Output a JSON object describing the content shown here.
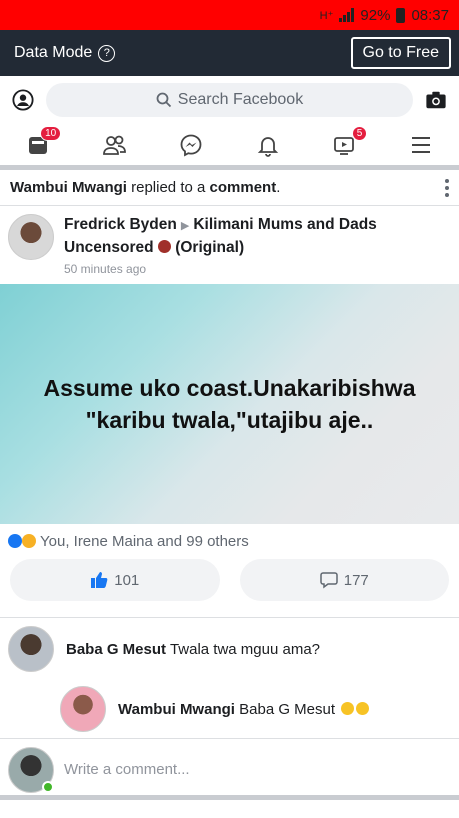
{
  "status_bar": {
    "network": "H⁺",
    "battery": "92%",
    "time": "08:37"
  },
  "data_mode": {
    "label": "Data Mode",
    "help_icon": "?",
    "button": "Go to Free"
  },
  "search": {
    "placeholder": "Search Facebook"
  },
  "nav": {
    "tabs": [
      {
        "icon": "news-feed-icon",
        "badge": "10"
      },
      {
        "icon": "friends-icon",
        "badge": ""
      },
      {
        "icon": "messenger-icon",
        "badge": ""
      },
      {
        "icon": "bell-icon",
        "badge": ""
      },
      {
        "icon": "watch-icon",
        "badge": "5"
      },
      {
        "icon": "menu-icon",
        "badge": ""
      }
    ]
  },
  "notification": {
    "actor": "Wambui Mwangi",
    "text": " replied to a ",
    "object": "comment",
    "suffix": "."
  },
  "post": {
    "author": "Fredrick Byden",
    "group": "Kilimani Mums and Dads",
    "group_line2": "Uncensored",
    "tag": "(Original)",
    "time": "50 minutes ago",
    "image_text_line1": "Assume uko coast.Unakaribishwa",
    "image_text_line2": "\"karibu twala,\"utajibu aje..",
    "reactions": "You, Irene Maina and 99 others",
    "likes": "101",
    "comments": "177"
  },
  "comments": [
    {
      "author": "Baba G Mesut",
      "text": "Twala twa mguu ama?"
    },
    {
      "author": "Wambui Mwangi",
      "text": "Baba G Mesut"
    }
  ],
  "composer": {
    "placeholder": "Write a comment..."
  }
}
